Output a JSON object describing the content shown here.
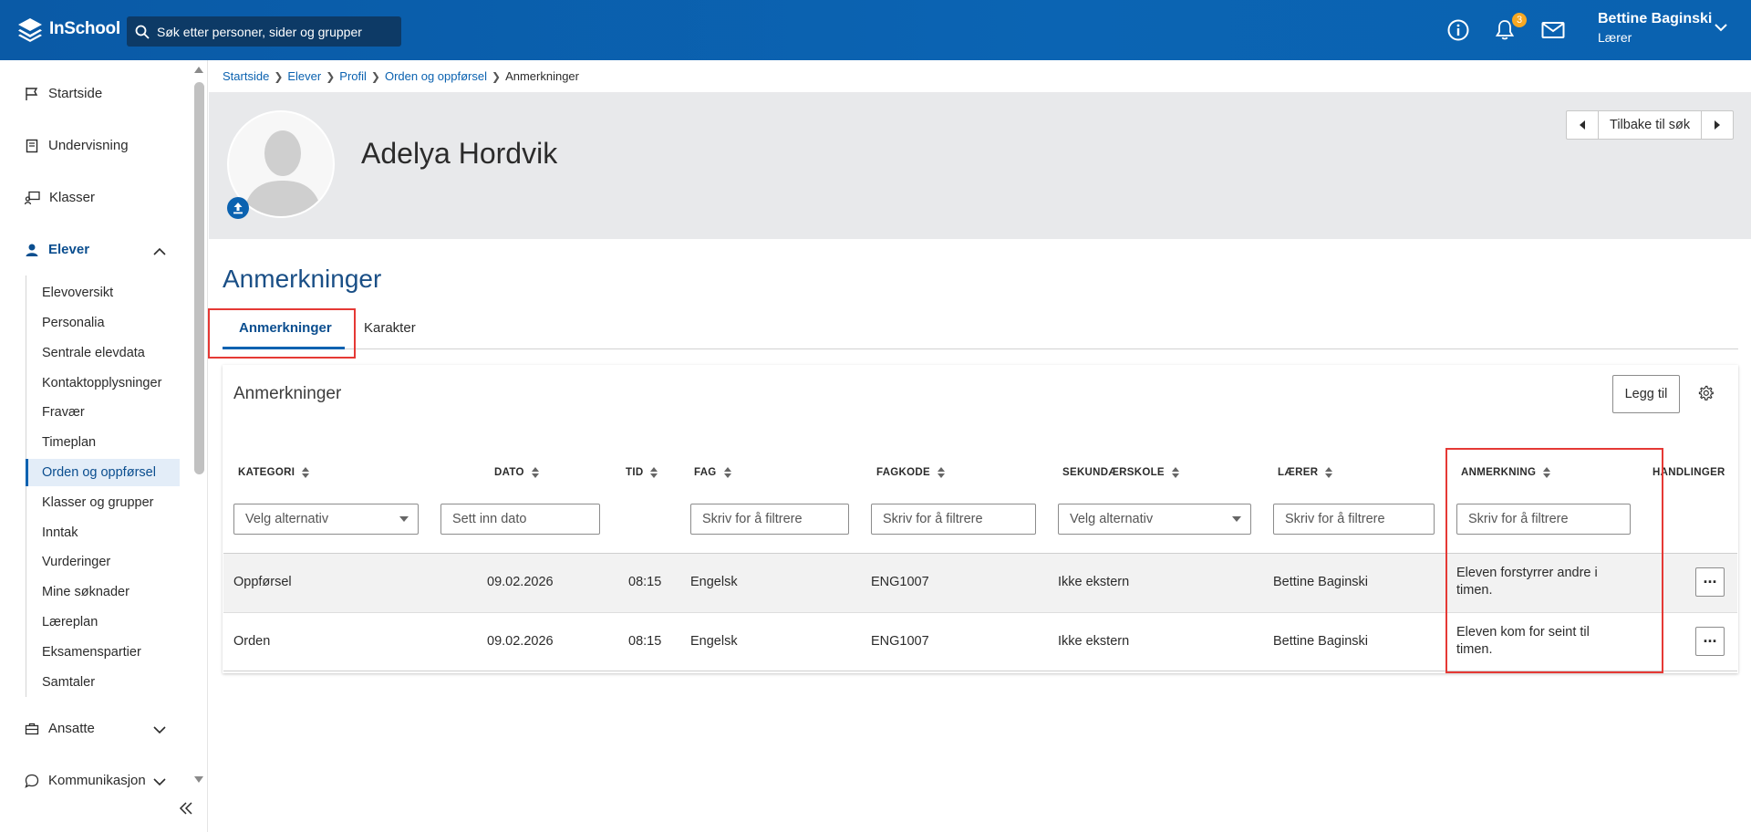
{
  "app": {
    "name": "InSchool"
  },
  "search": {
    "placeholder": "Søk etter personer, sider og grupper"
  },
  "notifications": {
    "count": "3"
  },
  "user": {
    "name": "Bettine Baginski",
    "role": "Lærer"
  },
  "sidebar": {
    "items": [
      {
        "label": "Startside",
        "icon": "flag-icon"
      },
      {
        "label": "Undervisning",
        "icon": "book-icon"
      },
      {
        "label": "Klasser",
        "icon": "chalkboard-icon"
      },
      {
        "label": "Elever",
        "icon": "student-icon"
      },
      {
        "label": "Ansatte",
        "icon": "briefcase-icon"
      },
      {
        "label": "Kommunikasjon",
        "icon": "chat-icon"
      }
    ],
    "sub_items": [
      {
        "label": "Elevoversikt"
      },
      {
        "label": "Personalia"
      },
      {
        "label": "Sentrale elevdata"
      },
      {
        "label": "Kontaktopplysninger"
      },
      {
        "label": "Fravær"
      },
      {
        "label": "Timeplan"
      },
      {
        "label": "Orden og oppførsel"
      },
      {
        "label": "Klasser og grupper"
      },
      {
        "label": "Inntak"
      },
      {
        "label": "Vurderinger"
      },
      {
        "label": "Mine søknader"
      },
      {
        "label": "Læreplan"
      },
      {
        "label": "Eksamenspartier"
      },
      {
        "label": "Samtaler"
      }
    ]
  },
  "breadcrumb": [
    "Startside",
    "Elever",
    "Profil",
    "Orden og oppførsel",
    "Anmerkninger"
  ],
  "profile": {
    "name": "Adelya Hordvik",
    "back_label": "Tilbake til søk"
  },
  "page": {
    "title": "Anmerkninger",
    "tabs": [
      {
        "label": "Anmerkninger"
      },
      {
        "label": "Karakter"
      }
    ]
  },
  "table": {
    "title": "Anmerkninger",
    "add_label": "Legg til",
    "columns": [
      "KATEGORI",
      "DATO",
      "TID",
      "FAG",
      "FAGKODE",
      "SEKUNDÆRSKOLE",
      "LÆRER",
      "ANMERKNING",
      "HANDLINGER"
    ],
    "filters": {
      "kategori": "Velg alternativ",
      "dato": "Sett inn dato",
      "fag": "Skriv for å filtrere",
      "fagkode": "Skriv for å filtrere",
      "sekundarskole": "Velg alternativ",
      "larer": "Skriv for å filtrere",
      "anmerkning": "Skriv for å filtrere"
    },
    "rows": [
      {
        "kategori": "Oppførsel",
        "dato": "09.02.2026",
        "tid": "08:15",
        "fag": "Engelsk",
        "fagkode": "ENG1007",
        "sekundarskole": "Ikke ekstern",
        "larer": "Bettine Baginski",
        "anmerkning_l1": "Eleven forstyrrer andre i",
        "anmerkning_l2": "timen.",
        "action": "..."
      },
      {
        "kategori": "Orden",
        "dato": "09.02.2026",
        "tid": "08:15",
        "fag": "Engelsk",
        "fagkode": "ENG1007",
        "sekundarskole": "Ikke ekstern",
        "larer": "Bettine Baginski",
        "anmerkning_l1": "Eleven kom for seint til",
        "anmerkning_l2": "timen.",
        "action": "..."
      }
    ]
  },
  "colors": {
    "header": "#0b62b0",
    "accent": "#0b4e8f",
    "highlight": "#e53935",
    "badge": "#f7a823"
  }
}
